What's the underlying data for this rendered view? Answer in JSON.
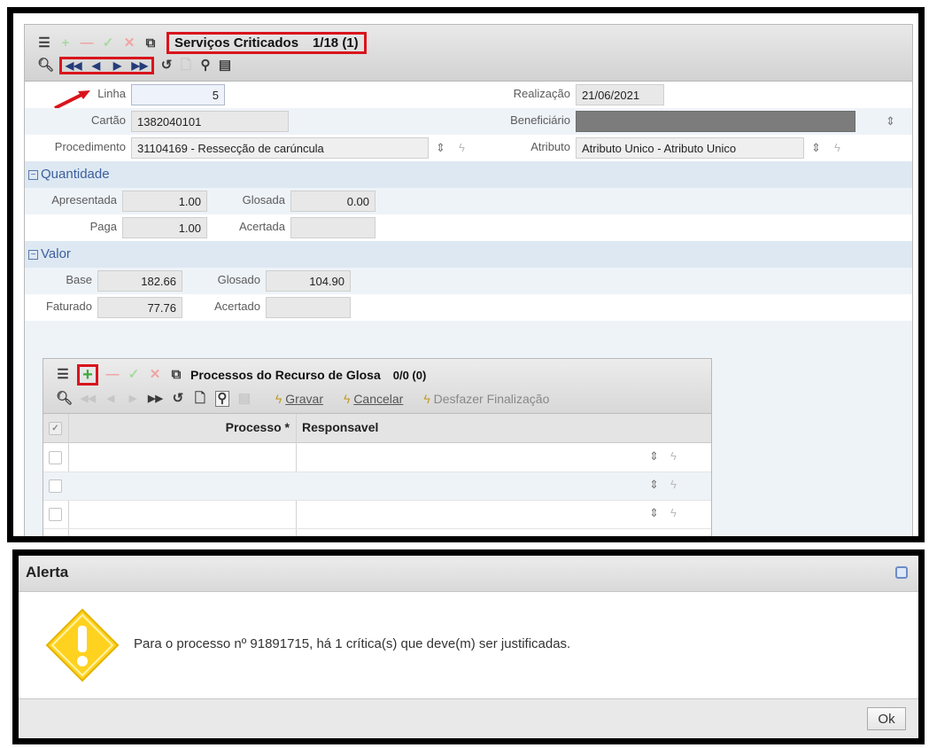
{
  "main_form": {
    "title": "Serviços Criticados",
    "record_nav": "1/18 (1)",
    "fields": {
      "linha": {
        "label": "Linha",
        "value": "5"
      },
      "realizacao": {
        "label": "Realização",
        "value": "21/06/2021"
      },
      "cartao": {
        "label": "Cartão",
        "value": "1382040101"
      },
      "beneficiario": {
        "label": "Beneficiário",
        "value": ""
      },
      "procedimento": {
        "label": "Procedimento",
        "value": "31104169 - Ressecção de carúncula"
      },
      "atributo": {
        "label": "Atributo",
        "value": "Atributo Unico - Atributo Unico"
      }
    },
    "quantidade": {
      "section": "Quantidade",
      "apresentada": {
        "label": "Apresentada",
        "value": "1.00"
      },
      "glosada": {
        "label": "Glosada",
        "value": "0.00"
      },
      "paga": {
        "label": "Paga",
        "value": "1.00"
      },
      "acertada": {
        "label": "Acertada",
        "value": ""
      }
    },
    "valor": {
      "section": "Valor",
      "base": {
        "label": "Base",
        "value": "182.66"
      },
      "glosado": {
        "label": "Glosado",
        "value": "104.90"
      },
      "faturado": {
        "label": "Faturado",
        "value": "77.76"
      },
      "acertado": {
        "label": "Acertado",
        "value": ""
      }
    }
  },
  "subpanel": {
    "title": "Processos do Recurso de Glosa",
    "record_nav": "0/0 (0)",
    "actions": {
      "gravar": "Gravar",
      "cancelar": "Cancelar",
      "desfazer": "Desfazer Finalização"
    },
    "columns": {
      "processo": "Processo *",
      "responsavel": "Responsavel"
    },
    "rows": 3
  },
  "alert": {
    "title": "Alerta",
    "message": "Para o processo nº 91891715, há 1 crítica(s) que deve(m) ser justificadas.",
    "ok": "Ok"
  },
  "colors": {
    "highlight_red": "#d9141c",
    "section_blue": "#3d5f9d",
    "warning_yellow": "#ffd21f"
  },
  "icons": [
    "list-icon",
    "add-icon",
    "remove-icon",
    "confirm-icon",
    "cancel-icon",
    "export-icon",
    "search-icon",
    "first-icon",
    "prev-icon",
    "next-icon",
    "last-icon",
    "refresh-icon",
    "document-icon",
    "link-icon",
    "grid-icon",
    "lightning-icon",
    "select-arrows-icon",
    "warning-icon",
    "close-icon"
  ]
}
